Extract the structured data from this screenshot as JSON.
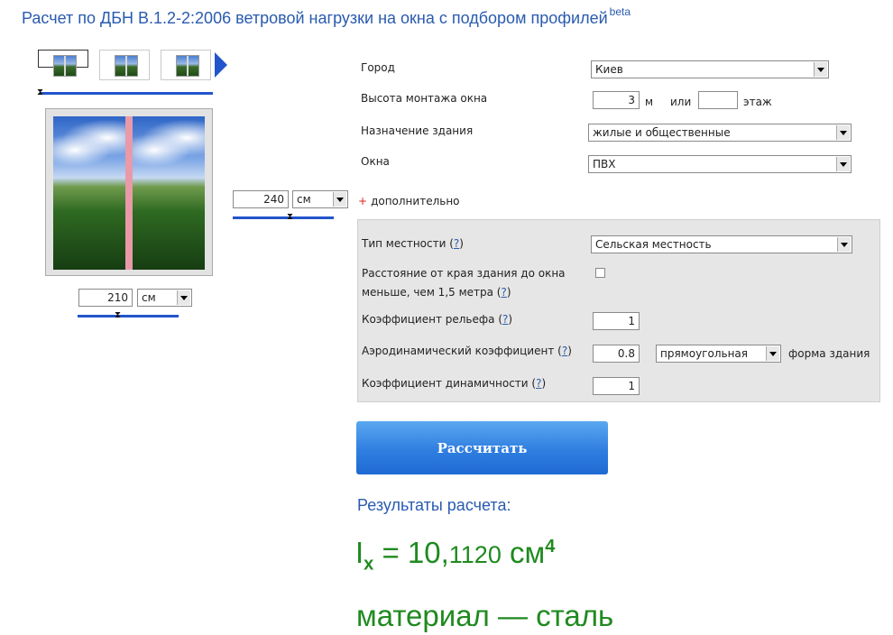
{
  "title": {
    "text": "Расчет по ДБН В.1.2-2:2006 ветровой нагрузки на окна с подбором профилей",
    "badge": "beta"
  },
  "window_types": [
    "one-sash",
    "two-sash",
    "three-sash"
  ],
  "dimensions": {
    "height": {
      "value": "240",
      "unit": "см"
    },
    "width": {
      "value": "210",
      "unit": "см"
    }
  },
  "form": {
    "city": {
      "label": "Город",
      "value": "Киев"
    },
    "mount_height": {
      "label": "Высота монтажа окна",
      "value": "3",
      "unit": "м",
      "or": "или",
      "floor_value": "",
      "floor_label": "этаж"
    },
    "building_purpose": {
      "label": "Назначение здания",
      "value": "жилые и общественные"
    },
    "windows": {
      "label": "Окна",
      "value": "ПВХ"
    },
    "advanced_toggle": {
      "plus": "+",
      "label": "дополнительно"
    }
  },
  "advanced": {
    "terrain": {
      "label": "Тип местности (",
      "help": "?",
      "label_end": ")",
      "value": "Сельская местность"
    },
    "edge_distance": {
      "line1": "Расстояние от края здания до окна",
      "line2": "меньше, чем 1,5 метра (",
      "help": "?",
      "label_end": ")",
      "checked": false
    },
    "relief": {
      "label": "Коэффициент рельефа (",
      "help": "?",
      "label_end": ")",
      "value": "1"
    },
    "aero": {
      "label": "Аэродинамический коэффициент (",
      "help": "?",
      "label_end": ")",
      "value": "0.8",
      "shape": "прямоугольная",
      "shape_label": "форма здания"
    },
    "dynamic": {
      "label": "Коэффициент динамичности (",
      "help": "?",
      "label_end": ")",
      "value": "1"
    }
  },
  "calculate_button": "Рассчитать",
  "results": {
    "title": "Результаты расчета:",
    "formula_symbol": "I",
    "formula_sub": "x",
    "formula_eq": " = 10,",
    "formula_digits": "1120",
    "formula_unit": " см",
    "formula_pow": "4",
    "material": "материал — сталь"
  },
  "colors": {
    "accent": "#2255cc",
    "link": "#2a5bb0",
    "result": "#1f8a1f",
    "button": "#2f7ee0"
  }
}
